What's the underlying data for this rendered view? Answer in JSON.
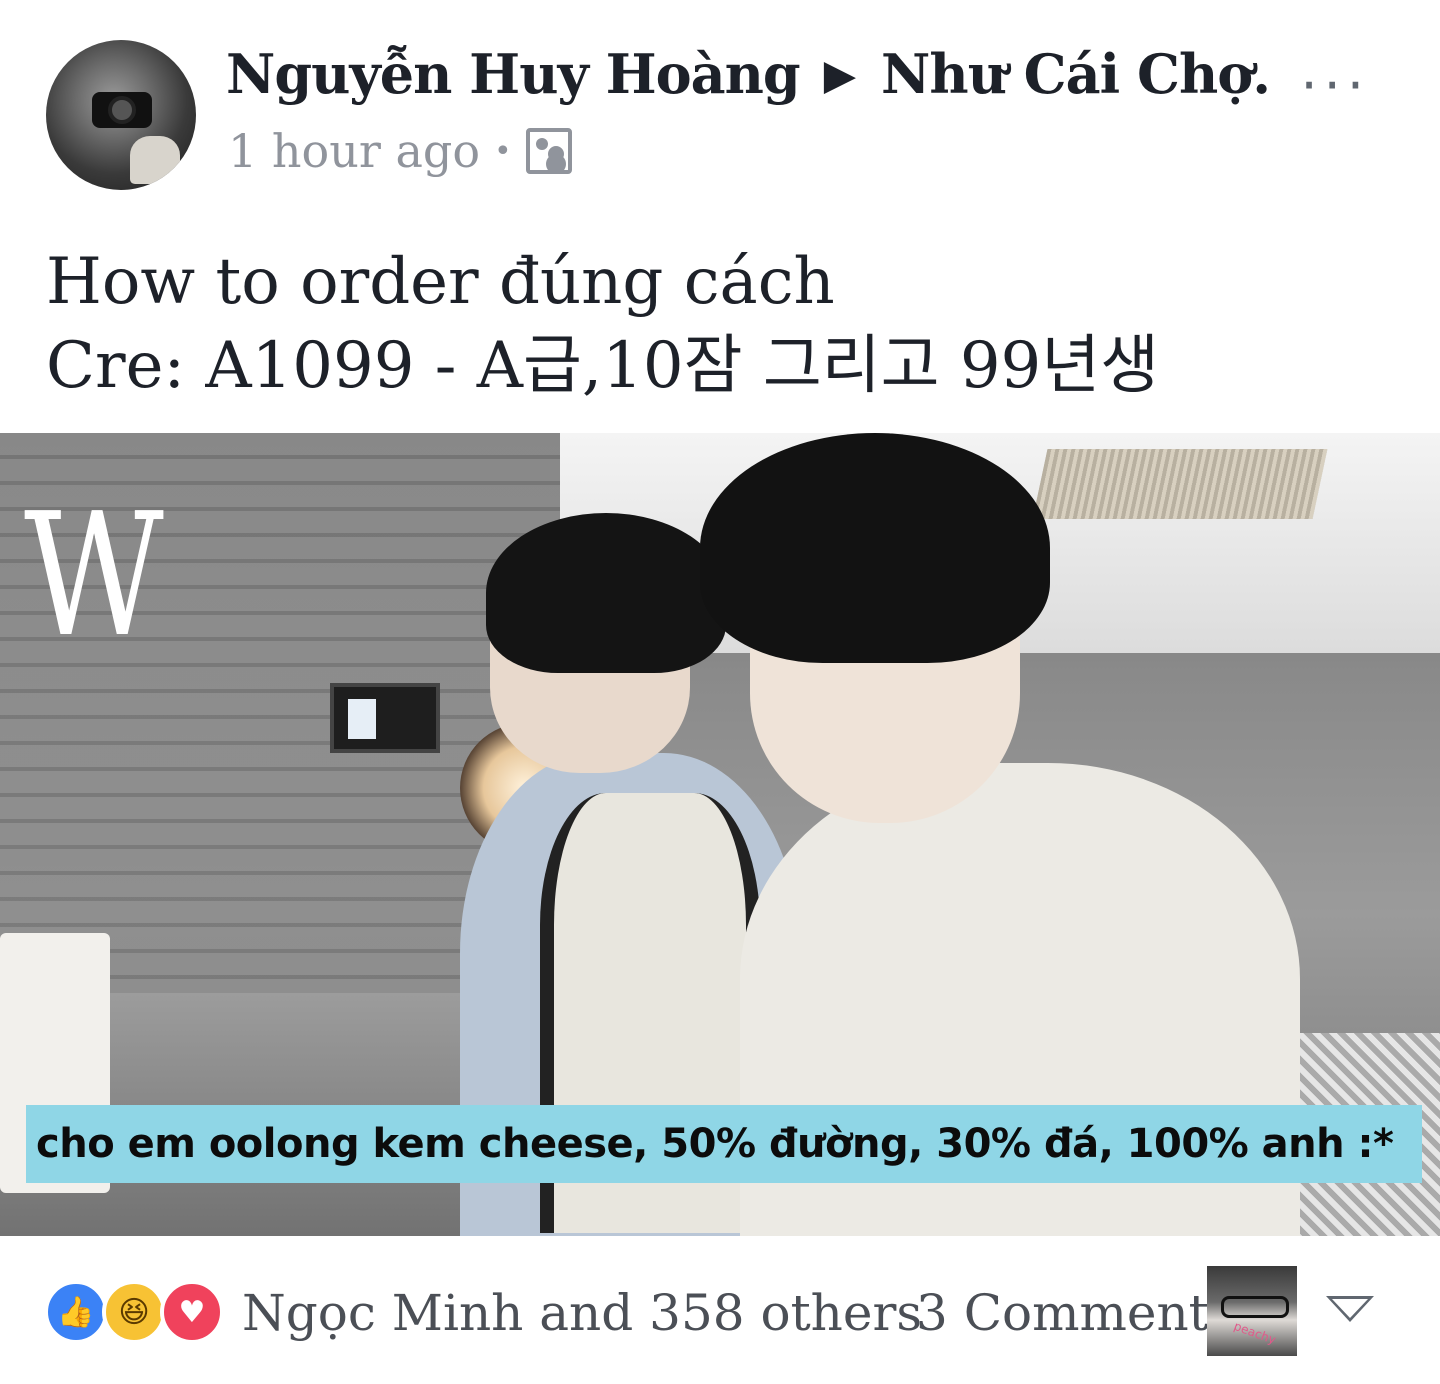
{
  "post": {
    "author": "Nguyễn Huy Hoàng",
    "separator": "▶",
    "group": "Như Cái Chợ.",
    "timestamp": "1 hour ago",
    "meta_separator": "•",
    "audience_icon": "photo-audience-icon",
    "more_icon": "more-options-icon",
    "more_glyph": "···",
    "text_lines": [
      "How to order đúng cách",
      "Cre: A1099 - A급,10잠 그리고 99년생"
    ]
  },
  "media": {
    "watermark": "W",
    "caption": "cho em oolong kem cheese, 50% đường, 30% đá, 100% anh :*"
  },
  "footer": {
    "reactions": [
      {
        "name": "like-reaction-icon",
        "glyph": "👍",
        "color": "#3b82f6"
      },
      {
        "name": "haha-reaction-icon",
        "glyph": "😆",
        "color": "#f7c234"
      },
      {
        "name": "love-reaction-icon",
        "glyph": "♥",
        "color": "#f0425c"
      }
    ],
    "likes_text": "Ngọc Minh and 358 others",
    "comments_text": "3 Comments",
    "commenter_avatar_text": "peachy",
    "dropdown_icon": "chevron-down-icon"
  },
  "colors": {
    "text_primary": "#1d2129",
    "text_secondary": "#90949c",
    "caption_bg": "#8fd6e6"
  }
}
